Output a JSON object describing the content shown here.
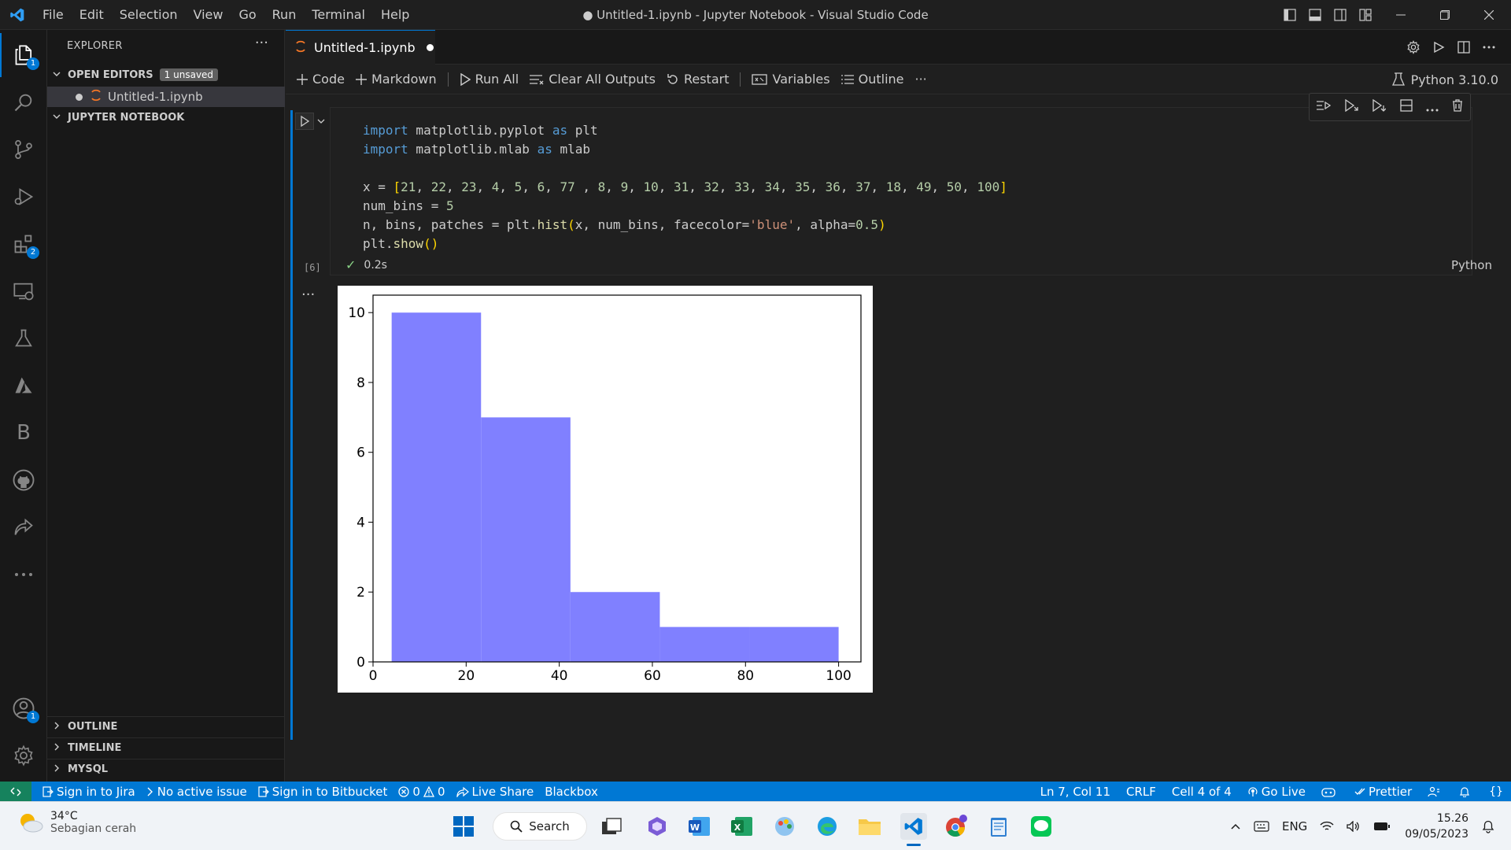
{
  "window": {
    "title": "● Untitled-1.ipynb - Jupyter Notebook - Visual Studio Code",
    "menu": [
      "File",
      "Edit",
      "Selection",
      "View",
      "Go",
      "Run",
      "Terminal",
      "Help"
    ]
  },
  "activity_bar": {
    "explorer_badge": "1",
    "extensions_badge": "2",
    "accounts_badge": "1",
    "blackbox_letter": "B"
  },
  "sidebar": {
    "title": "EXPLORER",
    "open_editors_label": "OPEN EDITORS",
    "unsaved_tag": "1 unsaved",
    "open_file": "Untitled-1.ipynb",
    "jupyter_label": "JUPYTER NOTEBOOK",
    "outline_label": "OUTLINE",
    "timeline_label": "TIMELINE",
    "mysql_label": "MYSQL"
  },
  "tab": {
    "label": "Untitled-1.ipynb"
  },
  "toolbar": {
    "code": "Code",
    "markdown": "Markdown",
    "run_all": "Run All",
    "clear_outputs": "Clear All Outputs",
    "restart": "Restart",
    "variables": "Variables",
    "outline": "Outline",
    "more": "···",
    "kernel": "Python 3.10.0"
  },
  "cell": {
    "exec_count": "[6]",
    "duration": "0.2s",
    "language": "Python",
    "output_more": "···"
  },
  "chart_data": {
    "type": "bar",
    "title": "",
    "xlabel": "",
    "ylabel": "",
    "bins": [
      4,
      23.2,
      42.4,
      61.6,
      80.8,
      100
    ],
    "values": [
      10,
      7,
      2,
      1,
      1
    ],
    "xlim": [
      0,
      104.8
    ],
    "ylim": [
      0,
      10.5
    ],
    "x_ticks": [
      0,
      20,
      40,
      60,
      80,
      100
    ],
    "y_ticks": [
      0,
      2,
      4,
      6,
      8,
      10
    ],
    "color": "#8080ff",
    "grid": false
  },
  "statusbar": {
    "jira": "Sign in to Jira",
    "issue": "No active issue",
    "bitbucket": "Sign in to Bitbucket",
    "errors": "0",
    "warnings": "0",
    "live_share": "Live Share",
    "blackbox": "Blackbox",
    "position": "Ln 7, Col 11",
    "eol": "CRLF",
    "cell_pos": "Cell 4 of 4",
    "go_live": "Go Live",
    "prettier": "Prettier"
  },
  "taskbar": {
    "temp": "34°C",
    "weather_desc": "Sebagian cerah",
    "search": "Search",
    "lang": "ENG",
    "time": "15.26",
    "date": "09/05/2023"
  },
  "colors": {
    "accent": "#0078d4",
    "remote": "#16825d",
    "jupyter_orange": "#f37626"
  }
}
